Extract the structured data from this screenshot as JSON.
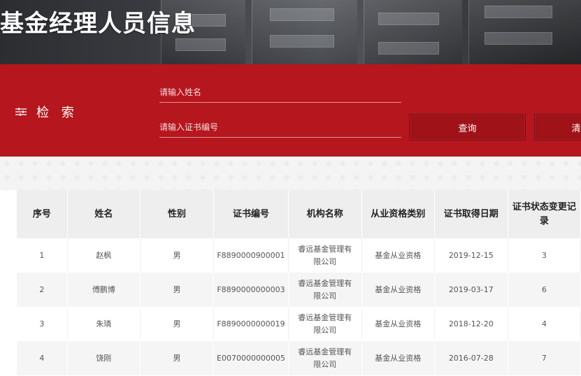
{
  "header": {
    "title": "基金经理人员信息"
  },
  "search": {
    "title": "检 索",
    "name_placeholder": "请输入姓名",
    "cert_placeholder": "请输入证书编号",
    "query_label": "查询",
    "clear_label": "清"
  },
  "table": {
    "columns": [
      "序号",
      "姓名",
      "性别",
      "证书编号",
      "机构名称",
      "从业资格类别",
      "证书取得日期",
      "证书状态变更记录"
    ],
    "rows": [
      [
        "1",
        "赵枫",
        "男",
        "F8890000900001",
        "睿远基金管理有限公司",
        "基金从业资格",
        "2019-12-15",
        "3"
      ],
      [
        "2",
        "傅鹏博",
        "男",
        "F8890000000003",
        "睿远基金管理有限公司",
        "基金从业资格",
        "2019-03-17",
        "6"
      ],
      [
        "3",
        "朱璘",
        "男",
        "F8890000000019",
        "睿远基金管理有限公司",
        "基金从业资格",
        "2018-12-20",
        "4"
      ],
      [
        "4",
        "饶刚",
        "男",
        "E0070000000005",
        "睿远基金管理有限公司",
        "基金从业资格",
        "2016-07-28",
        "7"
      ]
    ]
  }
}
